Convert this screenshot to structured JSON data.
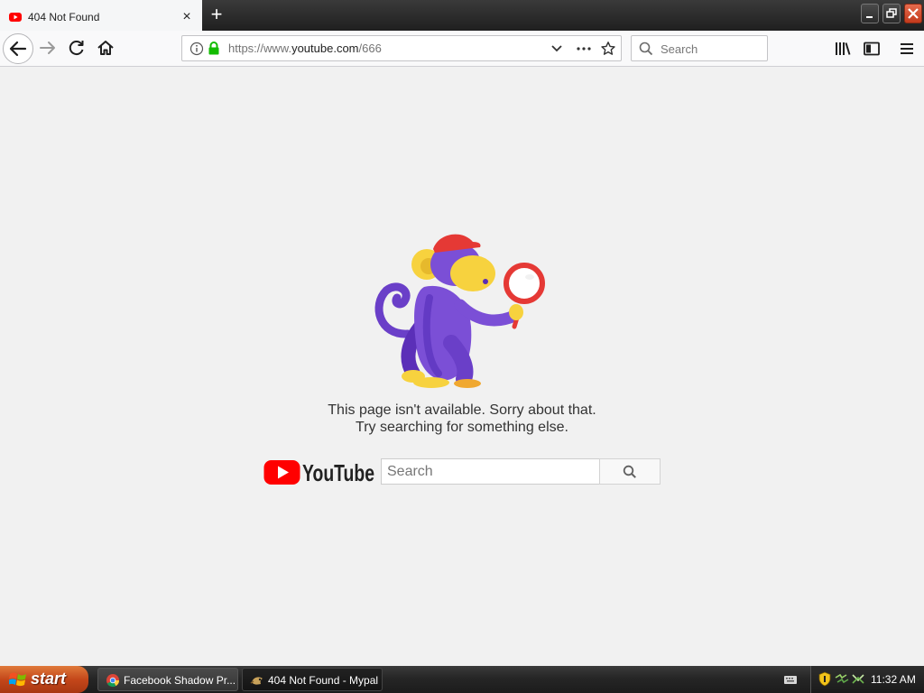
{
  "browser": {
    "tab": {
      "title": "404 Not Found",
      "close_glyph": "×",
      "icon": "youtube-favicon-icon"
    },
    "new_tab_glyph": "+",
    "window_controls": [
      "minimize-icon",
      "restore-icon",
      "close-icon"
    ],
    "url": {
      "scheme": "https://www.",
      "host": "youtube.com",
      "path": "/666"
    },
    "search": {
      "placeholder": "Search"
    }
  },
  "page": {
    "message_line1": "This page isn't available. Sorry about that.",
    "message_line2": "Try searching for something else.",
    "logo_text": "YouTube",
    "search_placeholder": "Search",
    "illustration": "monkey-with-magnifying-glass"
  },
  "taskbar": {
    "start_label": "start",
    "tasks": [
      {
        "label": "Facebook Shadow Pr...",
        "icon": "chrome-icon",
        "active": false
      },
      {
        "label": "404 Not Found - Mypal",
        "icon": "mypal-icon",
        "active": true
      }
    ],
    "tray_icons": [
      "keyboard-icon",
      "shield-icon",
      "network-icon",
      "network-icon"
    ],
    "clock": "11:32 AM"
  },
  "colors": {
    "youtube_red": "#ff0000",
    "monkey_purple": "#7b4fd6",
    "monkey_yellow": "#f7d23e",
    "hat_red": "#e53935",
    "start_orange": "#d2541f",
    "page_bg": "#f1f1f1"
  }
}
